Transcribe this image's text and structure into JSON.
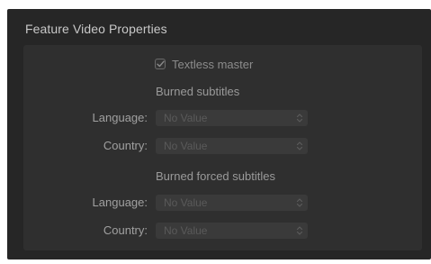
{
  "section": {
    "title": "Feature Video Properties"
  },
  "textless": {
    "label": "Textless master",
    "checked": true
  },
  "burned_subtitles": {
    "title": "Burned subtitles",
    "language_label": "Language:",
    "language_value": "No Value",
    "country_label": "Country:",
    "country_value": "No Value"
  },
  "burned_forced_subtitles": {
    "title": "Burned forced subtitles",
    "language_label": "Language:",
    "language_value": "No Value",
    "country_label": "Country:",
    "country_value": "No Value"
  },
  "icons": {
    "checkbox": "checkmark-icon",
    "select": "chevron-updown-icon"
  }
}
